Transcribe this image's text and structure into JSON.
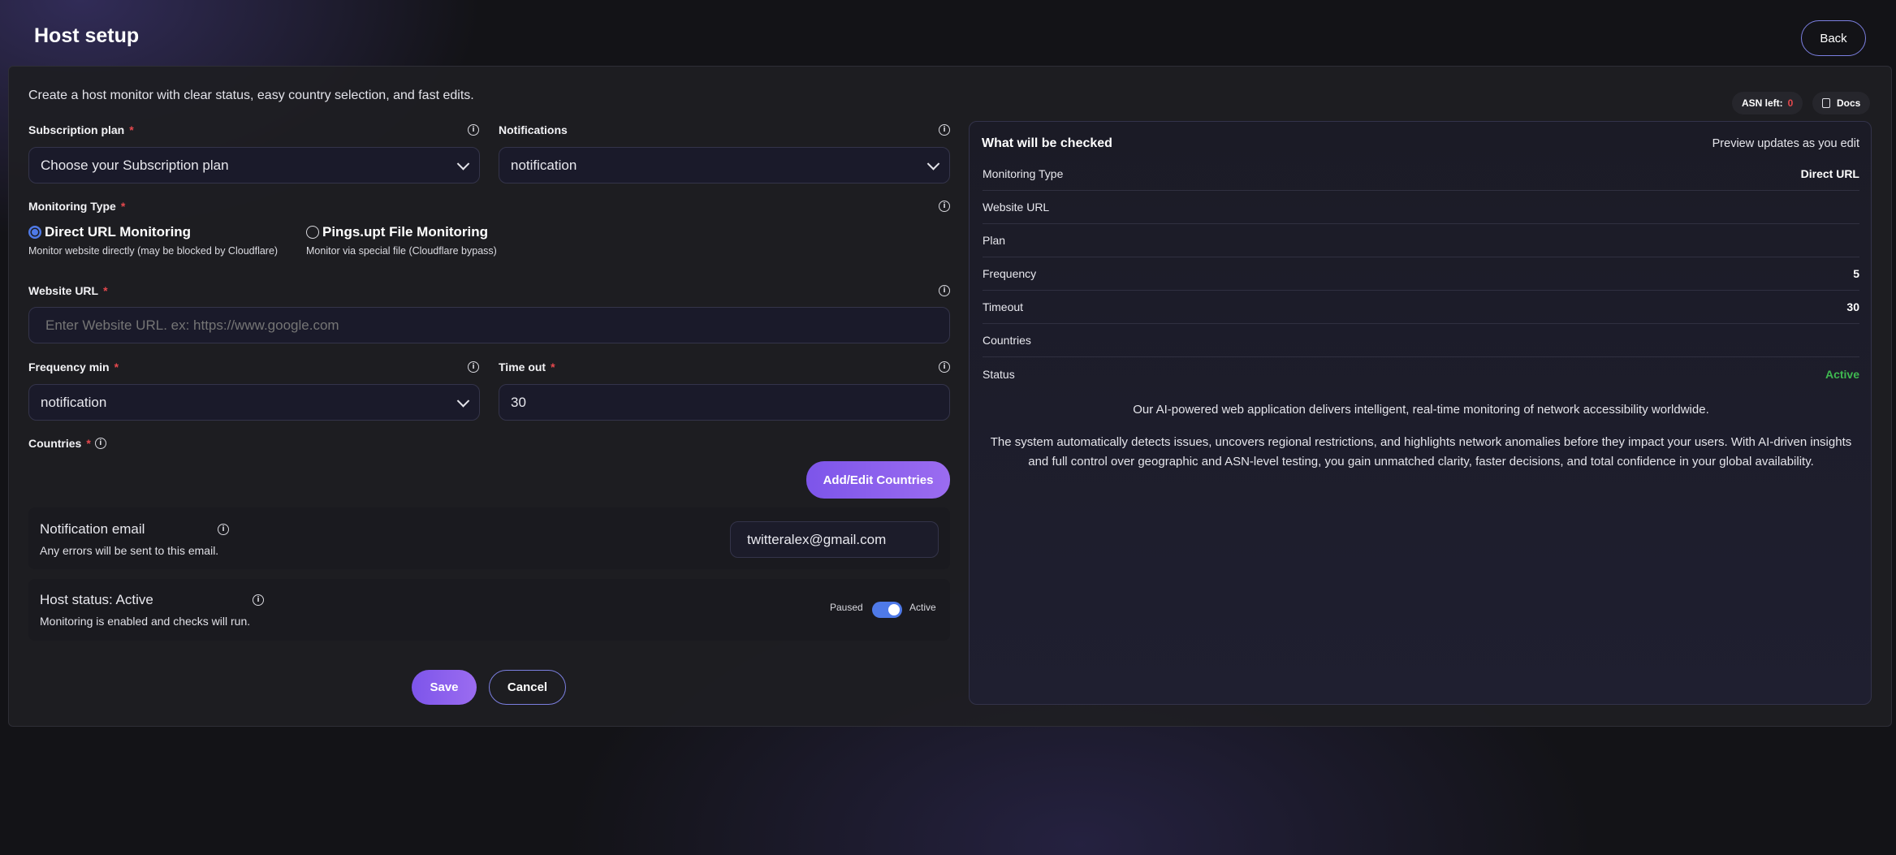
{
  "header": {
    "title": "Host setup",
    "back_label": "Back"
  },
  "description": "Create a host monitor with clear status, easy country selection, and fast edits.",
  "top_pills": {
    "asn_label": "ASN left:",
    "asn_value": "0",
    "docs_label": "Docs"
  },
  "form": {
    "subscription_plan": {
      "label": "Subscription plan",
      "value": "Choose your Subscription plan"
    },
    "notifications": {
      "label": "Notifications",
      "value": "notification"
    },
    "monitoring_type": {
      "label": "Monitoring Type",
      "options": [
        {
          "title": "Direct URL Monitoring",
          "subtitle": "Monitor website directly (may be blocked by Cloudflare)",
          "selected": true
        },
        {
          "title": "Pings.upt File Monitoring",
          "subtitle": "Monitor via special file (Cloudflare bypass)",
          "selected": false
        }
      ]
    },
    "website_url": {
      "label": "Website URL",
      "placeholder": "Enter Website URL. ex: https://www.google.com"
    },
    "frequency": {
      "label": "Frequency min",
      "value": "notification"
    },
    "timeout": {
      "label": "Time out",
      "value": "30"
    },
    "countries": {
      "label": "Countries",
      "button_label": "Add/Edit Countries"
    },
    "notification_email": {
      "title": "Notification email",
      "subtitle": "Any errors will be sent to this email.",
      "value": "twitteralex@gmail.com"
    },
    "host_status": {
      "title": "Host status: Active",
      "subtitle": "Monitoring is enabled and checks will run.",
      "off_label": "Paused",
      "on_label": "Active",
      "enabled": true
    },
    "save_label": "Save",
    "cancel_label": "Cancel"
  },
  "preview": {
    "title": "What will be checked",
    "hint": "Preview updates as you edit",
    "rows": [
      {
        "label": "Monitoring Type",
        "value": "Direct URL"
      },
      {
        "label": "Website URL",
        "value": ""
      },
      {
        "label": "Plan",
        "value": ""
      },
      {
        "label": "Frequency",
        "value": "5"
      },
      {
        "label": "Timeout",
        "value": "30"
      },
      {
        "label": "Countries",
        "value": ""
      },
      {
        "label": "Status",
        "value": "Active"
      }
    ],
    "paragraph1": "Our AI-powered web application delivers intelligent, real-time monitoring of network accessibility worldwide.",
    "paragraph2_line1": "The system automatically detects issues, uncovers regional restrictions, and highlights network anomalies before they impact your users. With AI-driven insights",
    "paragraph2_line2": "and full control over geographic and ASN-level testing, you gain unmatched clarity, faster decisions, and total confidence in your global availability."
  },
  "colors": {
    "accent_blue": "#4f7ae8",
    "accent_purple": "#8b5cf6",
    "status_green": "#3fb950",
    "required_red": "#e5484d"
  }
}
